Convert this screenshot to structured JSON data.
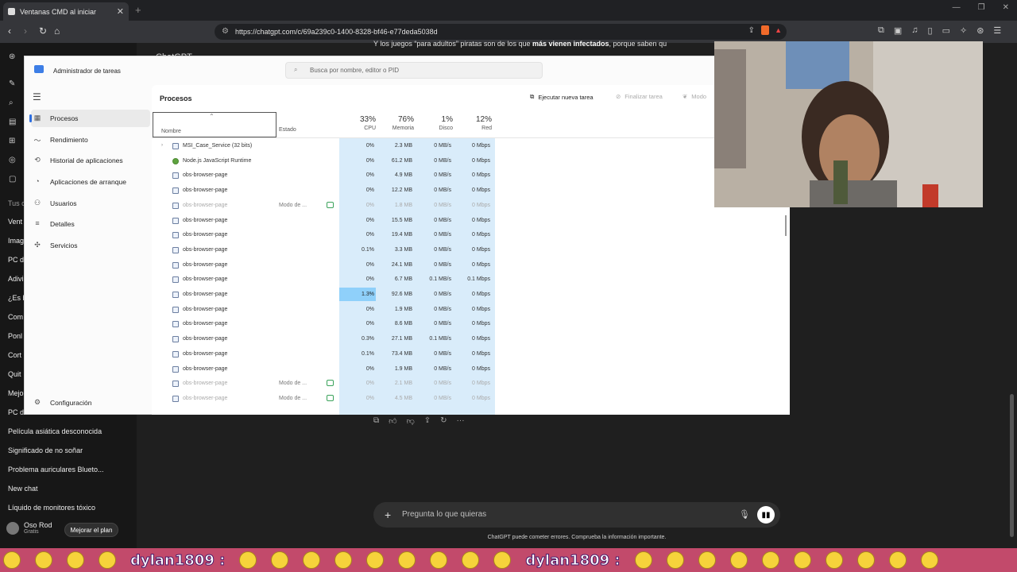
{
  "browser": {
    "tab_title": "Ventanas CMD al iniciar",
    "url": "https://chatgpt.com/c/69a239c0-1400-8328-bf46-e77deda5038d"
  },
  "chatgpt": {
    "header_title": "ChatGPT",
    "message_snippet_a": "Y los juegos “para adultos” piratas son de los que ",
    "message_snippet_bold": "más vienen infectados",
    "message_snippet_b": ", porque saben qu",
    "sidebar_fragments": [
      "Tus c",
      "Vent",
      "Imag",
      "PC d",
      "Adivi",
      "¿Es b",
      "Com",
      "Ponl",
      "Cort",
      "Quit",
      "Mejo",
      "PC d"
    ],
    "sidebar_chats": [
      "Película asiática desconocida",
      "Significado de no soñar",
      "Problema auriculares Blueto...",
      "New chat",
      "Líquido de monitores tóxico"
    ],
    "user_name": "Oso Rod",
    "user_plan": "Gratis",
    "upgrade_label": "Mejorar el plan",
    "composer_placeholder": "Pregunta lo que quieras",
    "disclaimer": "ChatGPT puede cometer errores. Comprueba la información importante."
  },
  "task_manager": {
    "title": "Administrador de tareas",
    "search_placeholder": "Busca por nombre, editor o PID",
    "nav": [
      {
        "label": "Procesos",
        "icon": "grid-icon"
      },
      {
        "label": "Rendimiento",
        "icon": "chart-icon"
      },
      {
        "label": "Historial de aplicaciones",
        "icon": "history-icon"
      },
      {
        "label": "Aplicaciones de arranque",
        "icon": "speedometer-icon"
      },
      {
        "label": "Usuarios",
        "icon": "users-icon"
      },
      {
        "label": "Detalles",
        "icon": "list-icon"
      },
      {
        "label": "Servicios",
        "icon": "puzzle-icon"
      }
    ],
    "settings_label": "Configuración",
    "section_title": "Procesos",
    "run_task_label": "Ejecutar nueva tarea",
    "end_task_label": "Finalizar tarea",
    "mode_label": "Modo",
    "columns": {
      "name": "Nombre",
      "status": "Estado",
      "cpu": {
        "pct": "33%",
        "label": "CPU"
      },
      "memory": {
        "pct": "76%",
        "label": "Memoria"
      },
      "disk": {
        "pct": "1%",
        "label": "Disco"
      },
      "network": {
        "pct": "12%",
        "label": "Red"
      }
    },
    "rows": [
      {
        "name": "MSI_Case_Service (32 bits)",
        "expand": true,
        "icon": "app",
        "status": "",
        "cpu": "0%",
        "mem": "2.3 MB",
        "disk": "0 MB/s",
        "net": "0 Mbps"
      },
      {
        "name": "Node.js JavaScript Runtime",
        "expand": false,
        "icon": "node",
        "status": "",
        "cpu": "0%",
        "mem": "61.2 MB",
        "disk": "0 MB/s",
        "net": "0 Mbps"
      },
      {
        "name": "obs-browser-page",
        "expand": false,
        "icon": "app",
        "status": "",
        "cpu": "0%",
        "mem": "4.9 MB",
        "disk": "0 MB/s",
        "net": "0 Mbps"
      },
      {
        "name": "obs-browser-page",
        "expand": false,
        "icon": "app",
        "status": "",
        "cpu": "0%",
        "mem": "12.2 MB",
        "disk": "0 MB/s",
        "net": "0 Mbps"
      },
      {
        "name": "obs-browser-page",
        "expand": false,
        "icon": "app",
        "status": "Modo de ...",
        "eco": true,
        "dim": true,
        "cpu": "0%",
        "mem": "1.8 MB",
        "disk": "0 MB/s",
        "net": "0 Mbps"
      },
      {
        "name": "obs-browser-page",
        "expand": false,
        "icon": "app",
        "status": "",
        "cpu": "0%",
        "mem": "15.5 MB",
        "disk": "0 MB/s",
        "net": "0 Mbps"
      },
      {
        "name": "obs-browser-page",
        "expand": false,
        "icon": "app",
        "status": "",
        "cpu": "0%",
        "mem": "19.4 MB",
        "disk": "0 MB/s",
        "net": "0 Mbps"
      },
      {
        "name": "obs-browser-page",
        "expand": false,
        "icon": "app",
        "status": "",
        "cpu": "0.1%",
        "mem": "3.3 MB",
        "disk": "0 MB/s",
        "net": "0 Mbps"
      },
      {
        "name": "obs-browser-page",
        "expand": false,
        "icon": "app",
        "status": "",
        "cpu": "0%",
        "mem": "24.1 MB",
        "disk": "0 MB/s",
        "net": "0 Mbps"
      },
      {
        "name": "obs-browser-page",
        "expand": false,
        "icon": "app",
        "status": "",
        "cpu": "0%",
        "mem": "6.7 MB",
        "disk": "0.1 MB/s",
        "net": "0.1 Mbps"
      },
      {
        "name": "obs-browser-page",
        "expand": false,
        "icon": "app",
        "status": "",
        "cpu": "1.3%",
        "cpu_hl": true,
        "mem": "92.6 MB",
        "disk": "0 MB/s",
        "net": "0 Mbps"
      },
      {
        "name": "obs-browser-page",
        "expand": false,
        "icon": "app",
        "status": "",
        "cpu": "0%",
        "mem": "1.9 MB",
        "disk": "0 MB/s",
        "net": "0 Mbps"
      },
      {
        "name": "obs-browser-page",
        "expand": false,
        "icon": "app",
        "status": "",
        "cpu": "0%",
        "mem": "8.6 MB",
        "disk": "0 MB/s",
        "net": "0 Mbps"
      },
      {
        "name": "obs-browser-page",
        "expand": false,
        "icon": "app",
        "status": "",
        "cpu": "0.3%",
        "mem": "27.1 MB",
        "disk": "0.1 MB/s",
        "net": "0 Mbps"
      },
      {
        "name": "obs-browser-page",
        "expand": false,
        "icon": "app",
        "status": "",
        "cpu": "0.1%",
        "mem": "73.4 MB",
        "disk": "0 MB/s",
        "net": "0 Mbps"
      },
      {
        "name": "obs-browser-page",
        "expand": false,
        "icon": "app",
        "status": "",
        "cpu": "0%",
        "mem": "1.9 MB",
        "disk": "0 MB/s",
        "net": "0 Mbps"
      },
      {
        "name": "obs-browser-page",
        "expand": false,
        "icon": "app",
        "status": "Modo de ...",
        "eco": true,
        "dim": true,
        "cpu": "0%",
        "mem": "2.1 MB",
        "disk": "0 MB/s",
        "net": "0 Mbps"
      },
      {
        "name": "obs-browser-page",
        "expand": false,
        "icon": "app",
        "status": "Modo de ...",
        "eco": true,
        "dim": true,
        "cpu": "0%",
        "mem": "4.5 MB",
        "disk": "0 MB/s",
        "net": "0 Mbps"
      }
    ]
  },
  "ticker": {
    "username": "dylan1809 :"
  },
  "colors": {
    "accent": "#2d6ee0",
    "cpu_highlight": "#8fd0fa",
    "cpu_column": "#d9ecfa",
    "ticker_bg": "#c24a6b"
  }
}
